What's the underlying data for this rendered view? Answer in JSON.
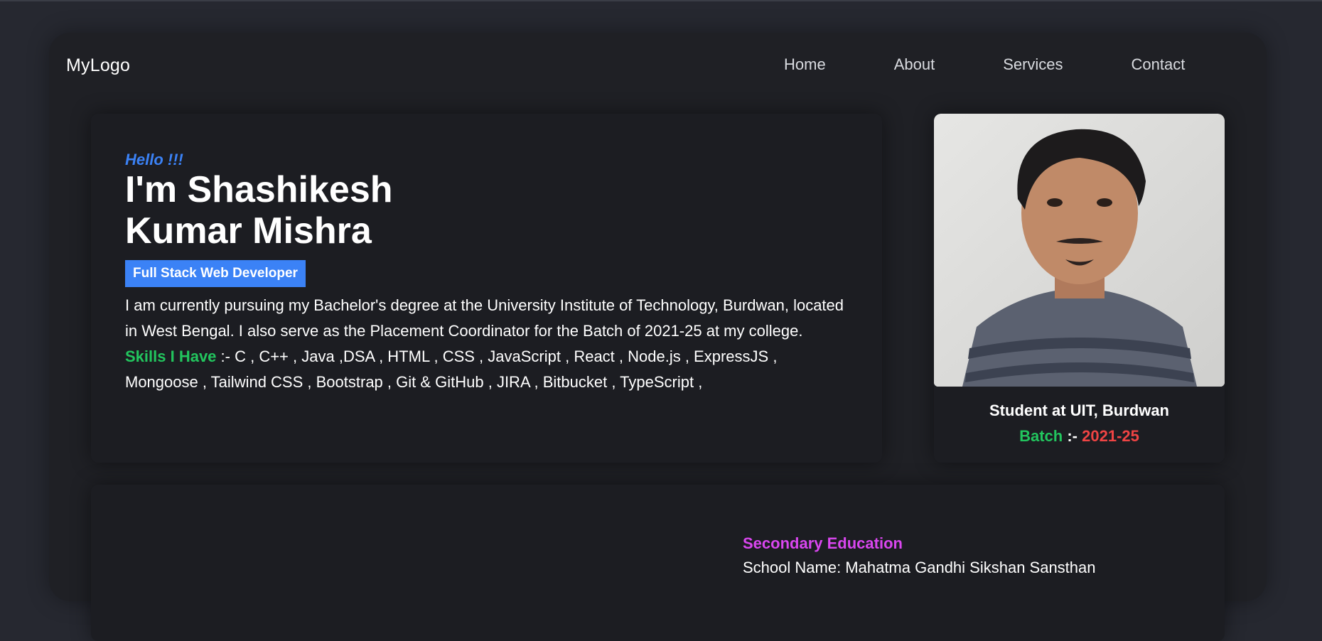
{
  "nav": {
    "logo": "MyLogo",
    "links": [
      "Home",
      "About",
      "Services",
      "Contact"
    ]
  },
  "intro": {
    "greeting": "Hello !!!",
    "name_line1": "I'm Shashikesh",
    "name_line2": "Kumar Mishra",
    "role": "Full Stack Web Developer",
    "bio": "I am currently pursuing my Bachelor's degree at the University Institute of Technology, Burdwan, located in West Bengal. I also serve as the Placement Coordinator for the Batch of 2021-25 at my college.",
    "skills_label": "Skills I Have",
    "skills": ":- C , C++ , Java ,DSA , HTML , CSS , JavaScript , React , Node.js , ExpressJS , Mongoose , Tailwind CSS , Bootstrap , Git & GitHub , JIRA , Bitbucket , TypeScript ,"
  },
  "profile": {
    "caption": "Student at UIT, Burdwan",
    "batch_label": "Batch",
    "batch_sep": " :- ",
    "batch_value": "2021-25"
  },
  "education": {
    "title": "Secondary Education",
    "school": "School Name: Mahatma Gandhi Sikshan Sansthan"
  },
  "colors": {
    "accent_blue": "#3b82f6",
    "skills_green": "#22c55e",
    "batch_red": "#ef4444",
    "edu_magenta": "#d946ef"
  }
}
